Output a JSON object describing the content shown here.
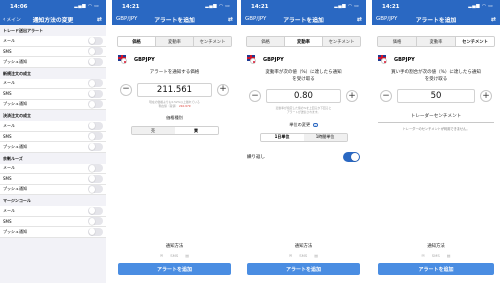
{
  "screen1": {
    "status_time": "14:06",
    "nav_back": "メイン",
    "nav_title": "通知方法の変更",
    "sections": [
      {
        "title": "トレード送出アラート",
        "rows": [
          "メール",
          "SMS",
          "プッシュ通知"
        ]
      },
      {
        "title": "新規注文の成立",
        "rows": [
          "メール",
          "SMS",
          "プッシュ通知"
        ]
      },
      {
        "title": "決済注文の成立",
        "rows": [
          "メール",
          "SMS",
          "プッシュ通知"
        ]
      },
      {
        "title": "余剰ルーズ",
        "rows": [
          "メール",
          "SMS",
          "プッシュ通知"
        ]
      },
      {
        "title": "マージンコール",
        "rows": [
          "メール",
          "SMS",
          "プッシュ通知"
        ]
      }
    ]
  },
  "common": {
    "status_time": "14:21",
    "ticker": "GBP/JPY",
    "nav_title": "アラートを追加",
    "pair_name": "GBPJPY",
    "tabs": [
      "価格",
      "変動率",
      "センチメント"
    ],
    "notify_method": "通知方法",
    "notify_icons": [
      "✉",
      "SMS",
      "▤"
    ],
    "add_button": "アラートを追加"
  },
  "screen2": {
    "prompt": "アラートを通知する価格",
    "value": "211.561",
    "note_line1": "現在の価格よりも0.52%以上離れている",
    "note_prefix": "現在値（買値）",
    "note_price": "210.979",
    "type_label": "価格種別",
    "type_options": [
      "売",
      "買"
    ]
  },
  "screen3": {
    "prompt_line1": "変動率が次の値（%）に達したら通知",
    "prompt_line2": "を受け取る",
    "value": "0.80",
    "note_line1": "変動率が指定した値の%を上回るか下回ると",
    "note_line2": "アラートが送信されます。",
    "unit_label": "単位の変更",
    "unit_options": [
      "1日単位",
      "1時間単位"
    ],
    "repeat_label": "繰り返し"
  },
  "screen4": {
    "prompt_line1": "買い手の割合が次の値（%）に達したら通知",
    "prompt_line2": "を受け取る",
    "value": "50",
    "sentiment_title": "トレーダーセンチメント",
    "sentiment_msg": "トレーダーのセンチメントが利用できません。"
  }
}
